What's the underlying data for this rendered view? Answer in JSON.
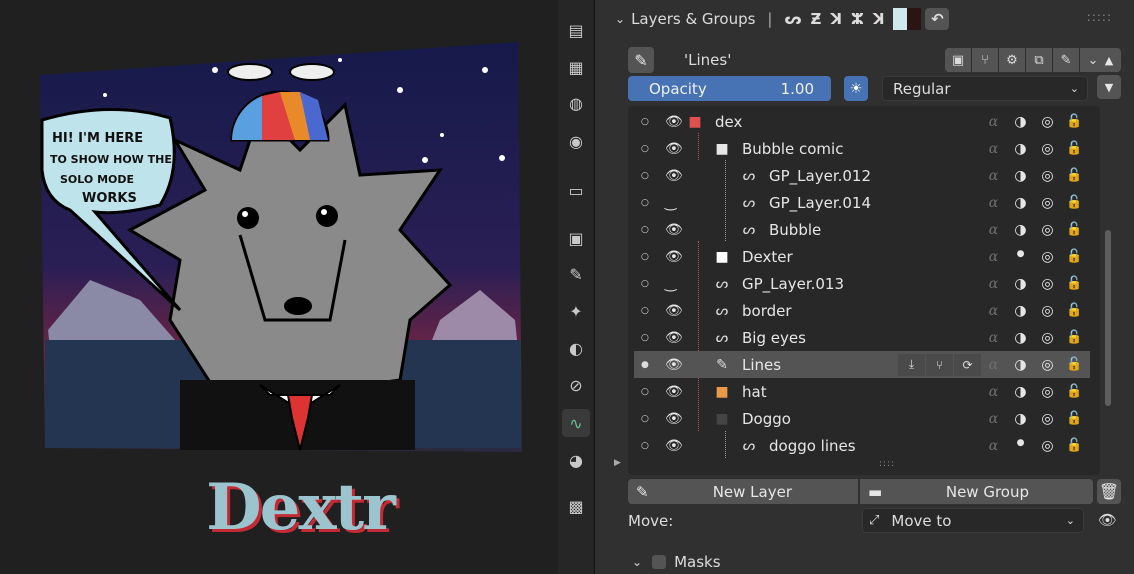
{
  "viewport": {
    "speech_bubble_lines": [
      "HI! I'M HERE",
      "TO SHOW HOW THE",
      "SOLO MODE",
      "WORKS"
    ],
    "caption": "Dextr"
  },
  "tabs": [
    {
      "icon": "tool-icon"
    },
    {
      "icon": "render-icon"
    },
    {
      "icon": "output-icon"
    },
    {
      "icon": "view-layer-icon"
    },
    {
      "icon": "scene-icon"
    },
    {
      "icon": "world-icon"
    },
    {
      "icon": "collection-icon"
    },
    {
      "icon": "object-icon"
    },
    {
      "icon": "modifiers-icon"
    },
    {
      "icon": "shader-fx-icon"
    },
    {
      "icon": "physics-icon"
    },
    {
      "icon": "constraints-icon"
    },
    {
      "icon": "object-data-gpencil-icon"
    },
    {
      "icon": "material-icon"
    },
    {
      "icon": "texture-icon"
    }
  ],
  "panel": {
    "header_title": "Layers & Groups",
    "active_layer_name": "'Lines'",
    "opacity_label": "Opacity",
    "opacity_value": "1.00",
    "blend_mode": "Regular",
    "items": [
      {
        "name": "dex",
        "type": "group",
        "depth": 0,
        "visible": true,
        "group_color": "#e05050"
      },
      {
        "name": "Bubble comic",
        "type": "group",
        "depth": 1,
        "visible": true,
        "group_color": "#e6e6e6"
      },
      {
        "name": "GP_Layer.012",
        "type": "layer",
        "depth": 2,
        "visible": true
      },
      {
        "name": "GP_Layer.014",
        "type": "layer",
        "depth": 2,
        "visible": false
      },
      {
        "name": "Bubble",
        "type": "layer",
        "depth": 2,
        "visible": true
      },
      {
        "name": "Dexter",
        "type": "group",
        "depth": 1,
        "visible": true,
        "group_color": "#ffffff"
      },
      {
        "name": "GP_Layer.013",
        "type": "layer",
        "depth": 1,
        "visible": false
      },
      {
        "name": "border",
        "type": "layer",
        "depth": 1,
        "visible": true
      },
      {
        "name": "Big eyes",
        "type": "layer",
        "depth": 1,
        "visible": true
      },
      {
        "name": "Lines",
        "type": "layer",
        "depth": 1,
        "visible": true,
        "selected": true
      },
      {
        "name": "hat",
        "type": "group",
        "depth": 1,
        "visible": true,
        "group_color": "#e89a48"
      },
      {
        "name": "Doggo",
        "type": "group",
        "depth": 1,
        "visible": true,
        "group_color": "#444444"
      },
      {
        "name": "doggo lines",
        "type": "layer",
        "depth": 2,
        "visible": true
      }
    ],
    "new_layer_label": "New Layer",
    "new_group_label": "New Group",
    "move_label": "Move:",
    "move_value": "Move to",
    "masks_label": "Masks"
  }
}
